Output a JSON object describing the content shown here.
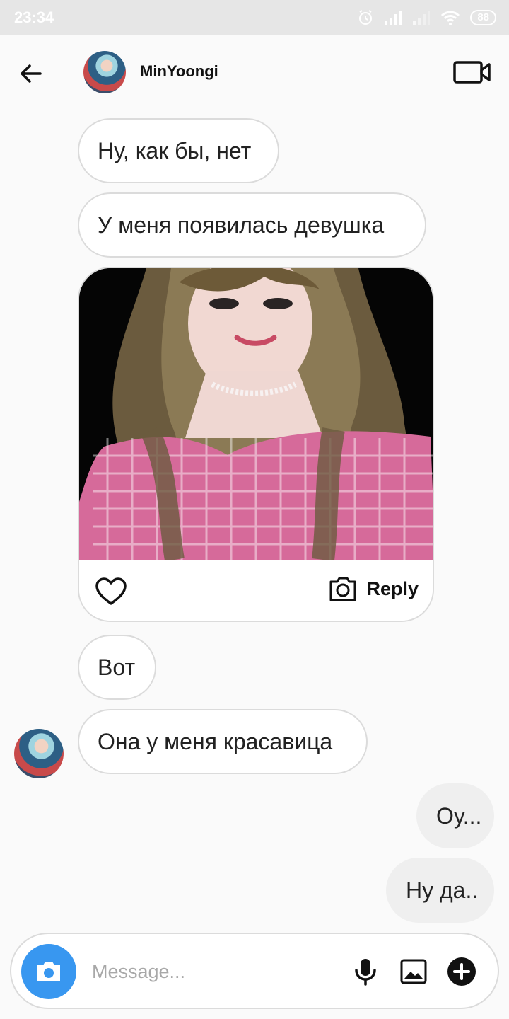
{
  "status": {
    "time": "23:34",
    "battery": "88",
    "icons": [
      "alarm-icon",
      "signal-icon",
      "signal-weak-icon",
      "wifi-icon",
      "battery-icon"
    ]
  },
  "header": {
    "name": "MinYoongi",
    "icons": [
      "back-arrow-icon",
      "video-call-icon"
    ]
  },
  "messages": [
    {
      "text": "Ну, как бы, нет",
      "sender": "other"
    },
    {
      "text": "У меня появилась девушка",
      "sender": "other"
    },
    {
      "type": "photo",
      "sender": "other",
      "reply_label": "Reply"
    },
    {
      "text": "Вот",
      "sender": "other"
    },
    {
      "text": "Она у меня красавица",
      "sender": "other"
    },
    {
      "text": "Оу...",
      "sender": "me"
    },
    {
      "text": "Ну да..",
      "sender": "me"
    }
  ],
  "composer": {
    "placeholder": "Message...",
    "value": "",
    "icons": [
      "camera-icon",
      "microphone-icon",
      "gallery-icon",
      "plus-icon"
    ]
  },
  "colors": {
    "accent": "#3897f0",
    "incoming_bubble": "#ffffff",
    "outgoing_bubble": "#efefef",
    "border": "#dbdbdb"
  }
}
